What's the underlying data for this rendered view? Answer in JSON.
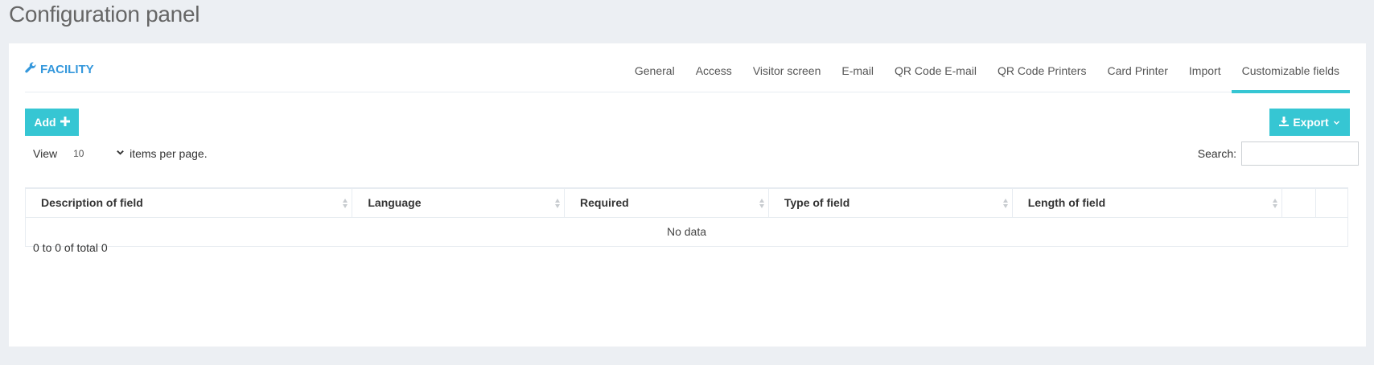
{
  "page": {
    "title": "Configuration panel"
  },
  "panel": {
    "caption": "FACILITY",
    "caption_icon": "wrench-icon",
    "tabs": [
      {
        "label": "General",
        "active": false
      },
      {
        "label": "Access",
        "active": false
      },
      {
        "label": "Visitor screen",
        "active": false
      },
      {
        "label": "E-mail",
        "active": false
      },
      {
        "label": "QR Code E-mail",
        "active": false
      },
      {
        "label": "QR Code Printers",
        "active": false
      },
      {
        "label": "Card Printer",
        "active": false
      },
      {
        "label": "Import",
        "active": false
      },
      {
        "label": "Customizable fields",
        "active": true
      }
    ]
  },
  "toolbar": {
    "add_label": "Add",
    "add_icon": "plus-icon",
    "export_label": "Export",
    "export_icon": "download-icon"
  },
  "paging": {
    "view_label": "View",
    "per_page_value": "10",
    "items_label": "items per page.",
    "search_label": "Search:",
    "search_value": ""
  },
  "table": {
    "columns": [
      "Description of field",
      "Language",
      "Required",
      "Type of field",
      "Length of field",
      "",
      ""
    ],
    "empty_text": "No data"
  },
  "footer": {
    "info": "0 to 0 of total 0"
  },
  "colors": {
    "accent": "#36c6d3",
    "caption": "#3598dc",
    "background": "#eceff3"
  }
}
